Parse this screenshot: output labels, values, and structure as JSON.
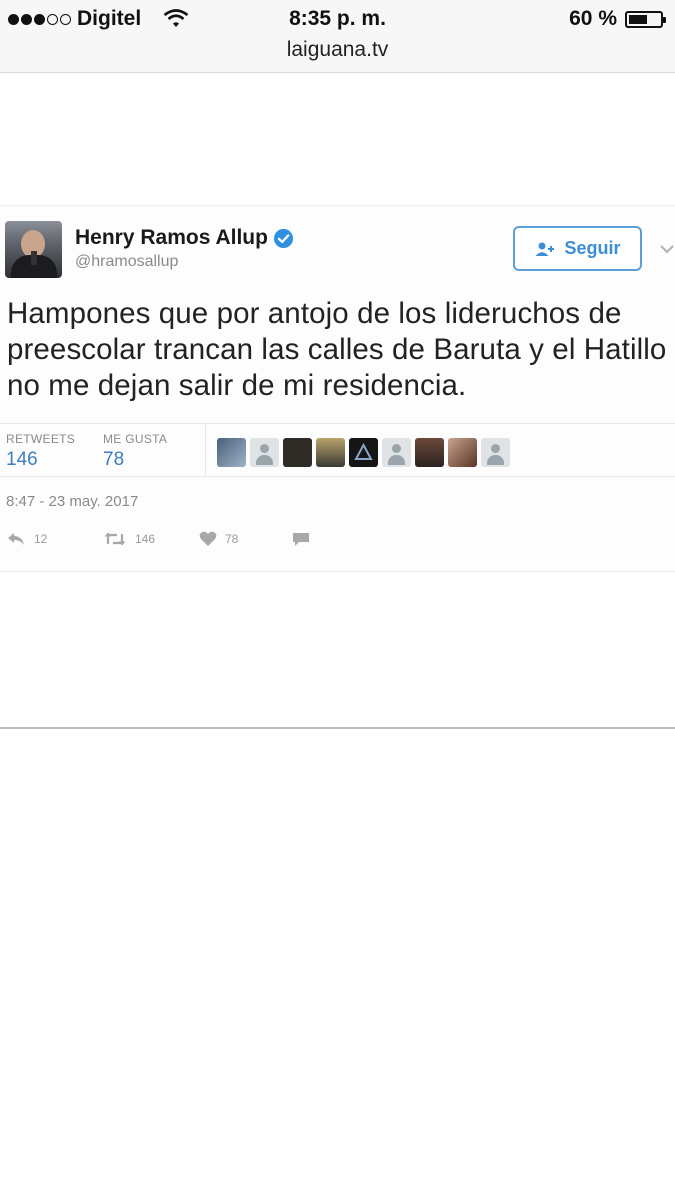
{
  "status_bar": {
    "carrier": "Digitel",
    "time": "8:35 p. m.",
    "battery": "60 %",
    "url": "laiguana.tv"
  },
  "tweet": {
    "author_name": "Henry Ramos Allup",
    "handle": "@hramosallup",
    "follow_label": "Seguir",
    "text": "Hampones que por antojo de los lideruchos de preescolar trancan las calles de Baruta y el Hatillo no me dejan salir de mi residencia.",
    "retweets_label": "RETWEETS",
    "retweets_count": "146",
    "likes_label": "ME GUSTA",
    "likes_count": "78",
    "timestamp": "8:47 - 23 may. 2017",
    "actions": {
      "reply_count": "12",
      "retweet_count": "146",
      "like_count": "78"
    }
  },
  "colors": {
    "accent": "#3b8ed4",
    "verified": "#2f8fe0",
    "stat_value": "#3b7dbf"
  },
  "icons": [
    "wifi-icon",
    "battery-icon",
    "verified-icon",
    "add-user-icon",
    "chevron-down-icon",
    "reply-icon",
    "retweet-icon",
    "heart-icon",
    "dm-icon"
  ]
}
